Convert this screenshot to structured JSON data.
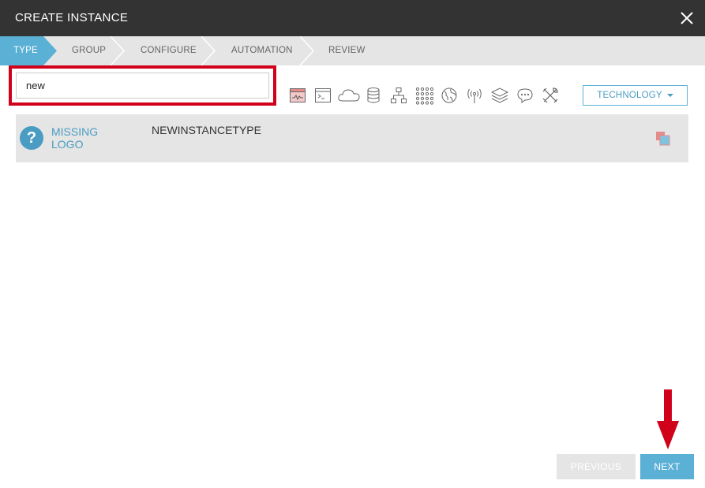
{
  "header": {
    "title": "CREATE INSTANCE",
    "close_icon": "close-icon"
  },
  "steps": [
    {
      "label": "TYPE",
      "active": true
    },
    {
      "label": "GROUP",
      "active": false
    },
    {
      "label": "CONFIGURE",
      "active": false
    },
    {
      "label": "AUTOMATION",
      "active": false
    },
    {
      "label": "REVIEW",
      "active": false
    }
  ],
  "search": {
    "value": "new",
    "placeholder": ""
  },
  "filters": [
    "web-app-icon",
    "terminal-icon",
    "cloud-icon",
    "database-icon",
    "network-icon",
    "grid-icon",
    "globe-icon",
    "broadcast-icon",
    "layers-icon",
    "chat-icon",
    "tools-icon"
  ],
  "technology_dropdown": {
    "label": "TECHNOLOGY"
  },
  "results": [
    {
      "logo_text": "MISSING LOGO",
      "logo_glyph": "?",
      "name": "NEWINSTANCETYPE"
    }
  ],
  "footer": {
    "previous_label": "PREVIOUS",
    "next_label": "NEXT"
  },
  "colors": {
    "accent": "#5bb0d6",
    "header_bg": "#333333",
    "highlight": "#d0021b",
    "row_bg": "#e5e5e5"
  }
}
